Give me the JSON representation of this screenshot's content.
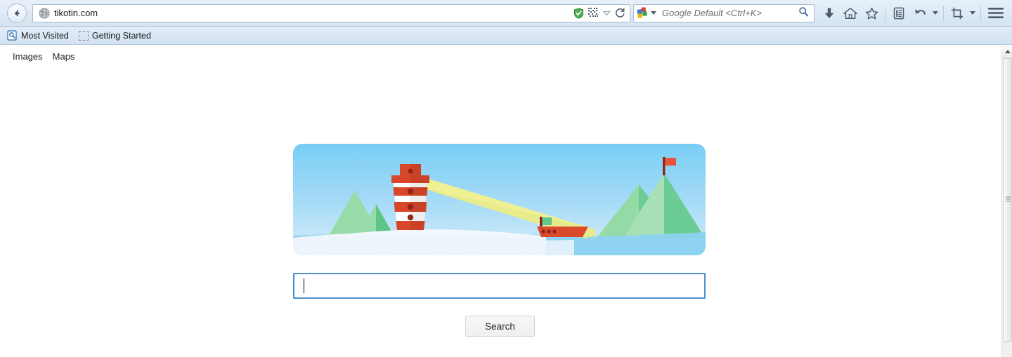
{
  "browser": {
    "back_button_label": "Back",
    "url": "tikotin.com",
    "url_icons": [
      {
        "name": "shield-check-icon",
        "title": "Security shield"
      },
      {
        "name": "qr-code-icon",
        "title": "QR code"
      },
      {
        "name": "dropdown-caret-icon",
        "title": "More"
      },
      {
        "name": "reload-icon",
        "title": "Reload"
      }
    ],
    "search": {
      "engine": "Google",
      "placeholder": "Google Default <Ctrl+K>",
      "value": "",
      "submit_icon": "magnifier-icon"
    },
    "toolbar_icons": [
      {
        "name": "download-icon",
        "title": "Downloads"
      },
      {
        "name": "home-icon",
        "title": "Home"
      },
      {
        "name": "bookmark-star-icon",
        "title": "Bookmark"
      },
      {
        "name": "reading-list-icon",
        "title": "Reading list"
      },
      {
        "name": "undo-icon",
        "title": "Undo close tab"
      },
      {
        "name": "undo-dropdown-icon",
        "title": "Undo options"
      },
      {
        "name": "screenshot-crop-icon",
        "title": "Screenshot"
      },
      {
        "name": "screenshot-dropdown-icon",
        "title": "Screenshot options"
      },
      {
        "name": "hamburger-menu-icon",
        "title": "Open menu"
      }
    ],
    "bookmarks": [
      {
        "label": "Most Visited",
        "icon": "most-visited-icon"
      },
      {
        "label": "Getting Started",
        "icon": "placeholder-icon"
      }
    ]
  },
  "page": {
    "nav_links": [
      {
        "label": "Images"
      },
      {
        "label": "Maps"
      }
    ],
    "doodle": {
      "alt": "Lighthouse doodle with boat and mountains",
      "scene_elements": [
        "sky",
        "snow-hill",
        "water",
        "left-mountains",
        "lighthouse",
        "light-beam",
        "boat",
        "right-mountains",
        "summit-flag"
      ]
    },
    "search_box": {
      "value": "",
      "placeholder": "",
      "focused": true
    },
    "search_button_label": "Search"
  },
  "scrollbar": {
    "up_arrow": "scroll-up-icon",
    "position": "top"
  },
  "colors": {
    "chrome_top": "#e7f0f8",
    "chrome_bottom": "#d5e4f2",
    "chrome_border": "#b6c8d9",
    "focus_blue": "#4d90c9",
    "sky_top": "#7fd0f5",
    "sky_bottom": "#cfeaf9",
    "lighthouse_red": "#d9472b",
    "lighthouse_dark": "#8e2518",
    "beam_yellow": "#e8e87a",
    "mountain_green": "#8fd9a3",
    "mountain_green_dark": "#5ec488",
    "water_blue": "#8ed3f2",
    "snow_white": "#f0f6fc",
    "boat_red": "#d9492c",
    "flag_green": "#5dc98c",
    "google_red": "#d94235",
    "google_blue": "#3d76d8",
    "google_green": "#36a852",
    "google_yellow": "#f2b800"
  }
}
